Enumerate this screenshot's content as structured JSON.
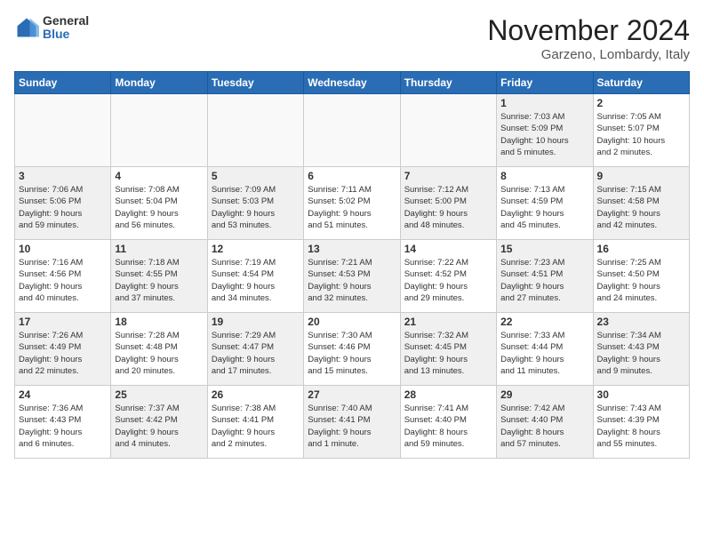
{
  "logo": {
    "general": "General",
    "blue": "Blue"
  },
  "title": "November 2024",
  "location": "Garzeno, Lombardy, Italy",
  "headers": [
    "Sunday",
    "Monday",
    "Tuesday",
    "Wednesday",
    "Thursday",
    "Friday",
    "Saturday"
  ],
  "rows": [
    [
      {
        "day": "",
        "info": "",
        "empty": true
      },
      {
        "day": "",
        "info": "",
        "empty": true
      },
      {
        "day": "",
        "info": "",
        "empty": true
      },
      {
        "day": "",
        "info": "",
        "empty": true
      },
      {
        "day": "",
        "info": "",
        "empty": true
      },
      {
        "day": "1",
        "info": "Sunrise: 7:03 AM\nSunset: 5:09 PM\nDaylight: 10 hours\nand 5 minutes.",
        "shaded": true
      },
      {
        "day": "2",
        "info": "Sunrise: 7:05 AM\nSunset: 5:07 PM\nDaylight: 10 hours\nand 2 minutes.",
        "shaded": false
      }
    ],
    [
      {
        "day": "3",
        "info": "Sunrise: 7:06 AM\nSunset: 5:06 PM\nDaylight: 9 hours\nand 59 minutes.",
        "shaded": true
      },
      {
        "day": "4",
        "info": "Sunrise: 7:08 AM\nSunset: 5:04 PM\nDaylight: 9 hours\nand 56 minutes.",
        "shaded": false
      },
      {
        "day": "5",
        "info": "Sunrise: 7:09 AM\nSunset: 5:03 PM\nDaylight: 9 hours\nand 53 minutes.",
        "shaded": true
      },
      {
        "day": "6",
        "info": "Sunrise: 7:11 AM\nSunset: 5:02 PM\nDaylight: 9 hours\nand 51 minutes.",
        "shaded": false
      },
      {
        "day": "7",
        "info": "Sunrise: 7:12 AM\nSunset: 5:00 PM\nDaylight: 9 hours\nand 48 minutes.",
        "shaded": true
      },
      {
        "day": "8",
        "info": "Sunrise: 7:13 AM\nSunset: 4:59 PM\nDaylight: 9 hours\nand 45 minutes.",
        "shaded": false
      },
      {
        "day": "9",
        "info": "Sunrise: 7:15 AM\nSunset: 4:58 PM\nDaylight: 9 hours\nand 42 minutes.",
        "shaded": true
      }
    ],
    [
      {
        "day": "10",
        "info": "Sunrise: 7:16 AM\nSunset: 4:56 PM\nDaylight: 9 hours\nand 40 minutes.",
        "shaded": false
      },
      {
        "day": "11",
        "info": "Sunrise: 7:18 AM\nSunset: 4:55 PM\nDaylight: 9 hours\nand 37 minutes.",
        "shaded": true
      },
      {
        "day": "12",
        "info": "Sunrise: 7:19 AM\nSunset: 4:54 PM\nDaylight: 9 hours\nand 34 minutes.",
        "shaded": false
      },
      {
        "day": "13",
        "info": "Sunrise: 7:21 AM\nSunset: 4:53 PM\nDaylight: 9 hours\nand 32 minutes.",
        "shaded": true
      },
      {
        "day": "14",
        "info": "Sunrise: 7:22 AM\nSunset: 4:52 PM\nDaylight: 9 hours\nand 29 minutes.",
        "shaded": false
      },
      {
        "day": "15",
        "info": "Sunrise: 7:23 AM\nSunset: 4:51 PM\nDaylight: 9 hours\nand 27 minutes.",
        "shaded": true
      },
      {
        "day": "16",
        "info": "Sunrise: 7:25 AM\nSunset: 4:50 PM\nDaylight: 9 hours\nand 24 minutes.",
        "shaded": false
      }
    ],
    [
      {
        "day": "17",
        "info": "Sunrise: 7:26 AM\nSunset: 4:49 PM\nDaylight: 9 hours\nand 22 minutes.",
        "shaded": true
      },
      {
        "day": "18",
        "info": "Sunrise: 7:28 AM\nSunset: 4:48 PM\nDaylight: 9 hours\nand 20 minutes.",
        "shaded": false
      },
      {
        "day": "19",
        "info": "Sunrise: 7:29 AM\nSunset: 4:47 PM\nDaylight: 9 hours\nand 17 minutes.",
        "shaded": true
      },
      {
        "day": "20",
        "info": "Sunrise: 7:30 AM\nSunset: 4:46 PM\nDaylight: 9 hours\nand 15 minutes.",
        "shaded": false
      },
      {
        "day": "21",
        "info": "Sunrise: 7:32 AM\nSunset: 4:45 PM\nDaylight: 9 hours\nand 13 minutes.",
        "shaded": true
      },
      {
        "day": "22",
        "info": "Sunrise: 7:33 AM\nSunset: 4:44 PM\nDaylight: 9 hours\nand 11 minutes.",
        "shaded": false
      },
      {
        "day": "23",
        "info": "Sunrise: 7:34 AM\nSunset: 4:43 PM\nDaylight: 9 hours\nand 9 minutes.",
        "shaded": true
      }
    ],
    [
      {
        "day": "24",
        "info": "Sunrise: 7:36 AM\nSunset: 4:43 PM\nDaylight: 9 hours\nand 6 minutes.",
        "shaded": false
      },
      {
        "day": "25",
        "info": "Sunrise: 7:37 AM\nSunset: 4:42 PM\nDaylight: 9 hours\nand 4 minutes.",
        "shaded": true
      },
      {
        "day": "26",
        "info": "Sunrise: 7:38 AM\nSunset: 4:41 PM\nDaylight: 9 hours\nand 2 minutes.",
        "shaded": false
      },
      {
        "day": "27",
        "info": "Sunrise: 7:40 AM\nSunset: 4:41 PM\nDaylight: 9 hours\nand 1 minute.",
        "shaded": true
      },
      {
        "day": "28",
        "info": "Sunrise: 7:41 AM\nSunset: 4:40 PM\nDaylight: 8 hours\nand 59 minutes.",
        "shaded": false
      },
      {
        "day": "29",
        "info": "Sunrise: 7:42 AM\nSunset: 4:40 PM\nDaylight: 8 hours\nand 57 minutes.",
        "shaded": true
      },
      {
        "day": "30",
        "info": "Sunrise: 7:43 AM\nSunset: 4:39 PM\nDaylight: 8 hours\nand 55 minutes.",
        "shaded": false
      }
    ]
  ]
}
